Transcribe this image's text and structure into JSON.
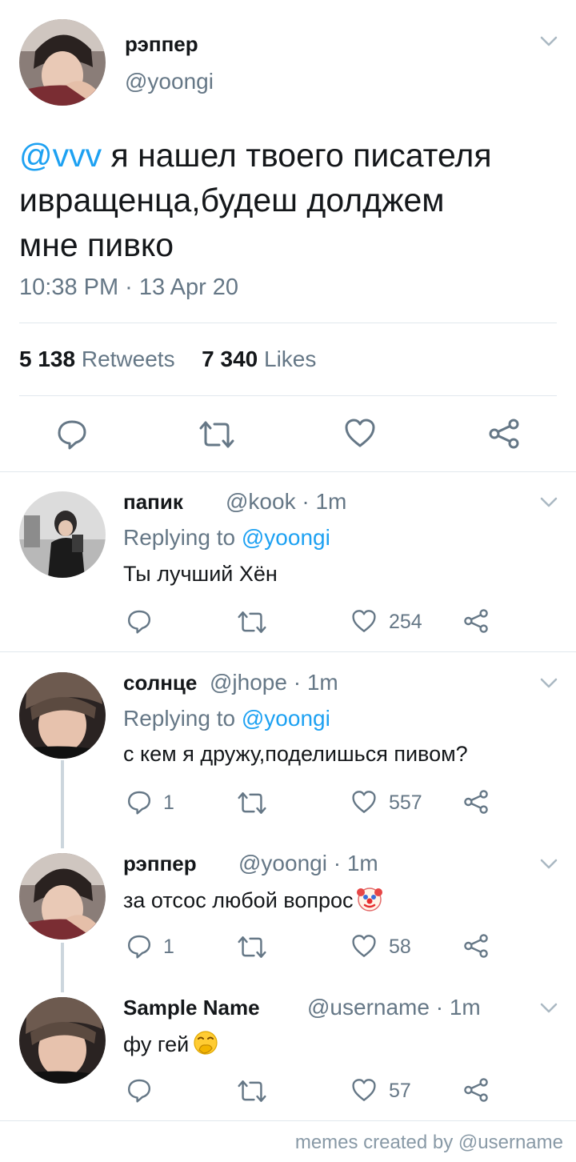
{
  "main_tweet": {
    "name": "рэппер",
    "handle": "@yoongi",
    "mention": "@vvv",
    "text_line1": " я нашел твоего писателя",
    "text_line2": "ивращенца,будеш долджем",
    "text_line3": "мне пивко",
    "timestamp": "10:38 PM · 13 Apr 20",
    "retweets_count": "5 138",
    "retweets_label": "Retweets",
    "likes_count": "7 340",
    "likes_label": "Likes"
  },
  "replies": [
    {
      "name": "папик",
      "handle": "@kook · 1m",
      "replying_prefix": "Replying to ",
      "replying_to": "@yoongi",
      "text": "Ты лучший Хён",
      "reply_count": "",
      "like_count": "254"
    },
    {
      "name": "солнце",
      "handle": "@jhope · 1m",
      "replying_prefix": "Replying to ",
      "replying_to": "@yoongi",
      "text": "с кем я дружу,поделишься пивом?",
      "reply_count": "1",
      "like_count": "557"
    },
    {
      "name": "рэппер",
      "handle": "@yoongi · 1m",
      "text": "за отсос любой вопрос",
      "emoji": "clown-face-icon",
      "reply_count": "1",
      "like_count": "58"
    },
    {
      "name": "Sample Name",
      "handle": "@username · 1m",
      "text": "фу гей",
      "emoji": "hand-over-mouth-icon",
      "reply_count": "",
      "like_count": "57"
    }
  ],
  "footer": {
    "watermark": "memes created by @username"
  },
  "colors": {
    "accent": "#1da1f2",
    "secondary_text": "#657786",
    "divider": "#e1e8ed"
  }
}
